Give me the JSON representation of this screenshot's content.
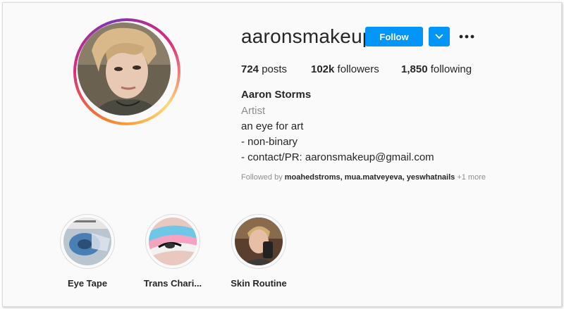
{
  "profile": {
    "username": "aaronsmakeup",
    "follow_label": "Follow",
    "stats": {
      "posts_count": "724",
      "posts_label": "posts",
      "followers_count": "102k",
      "followers_label": "followers",
      "following_count": "1,850",
      "following_label": "following"
    },
    "full_name": "Aaron Storms",
    "category": "Artist",
    "bio_lines": [
      "an eye for art",
      "- non-binary",
      "- contact/PR: aaronsmakeup@gmail.com"
    ],
    "followed_by": {
      "prefix": "Followed by ",
      "names": "moahedstroms, mua.matveyeva, yeswhatnails",
      "more": " +1 more"
    }
  },
  "highlights": [
    {
      "label": "Eye Tape"
    },
    {
      "label": "Trans Chari..."
    },
    {
      "label": "Skin Routine"
    }
  ],
  "icons": {
    "dropdown": "chevron-down-icon",
    "more": "more-options-icon"
  },
  "colors": {
    "follow_button": "#0095f6",
    "category_text": "#8e8e8e",
    "ring_gradient": [
      "#f58529",
      "#dd2a7b",
      "#8134af",
      "#feda77"
    ]
  }
}
